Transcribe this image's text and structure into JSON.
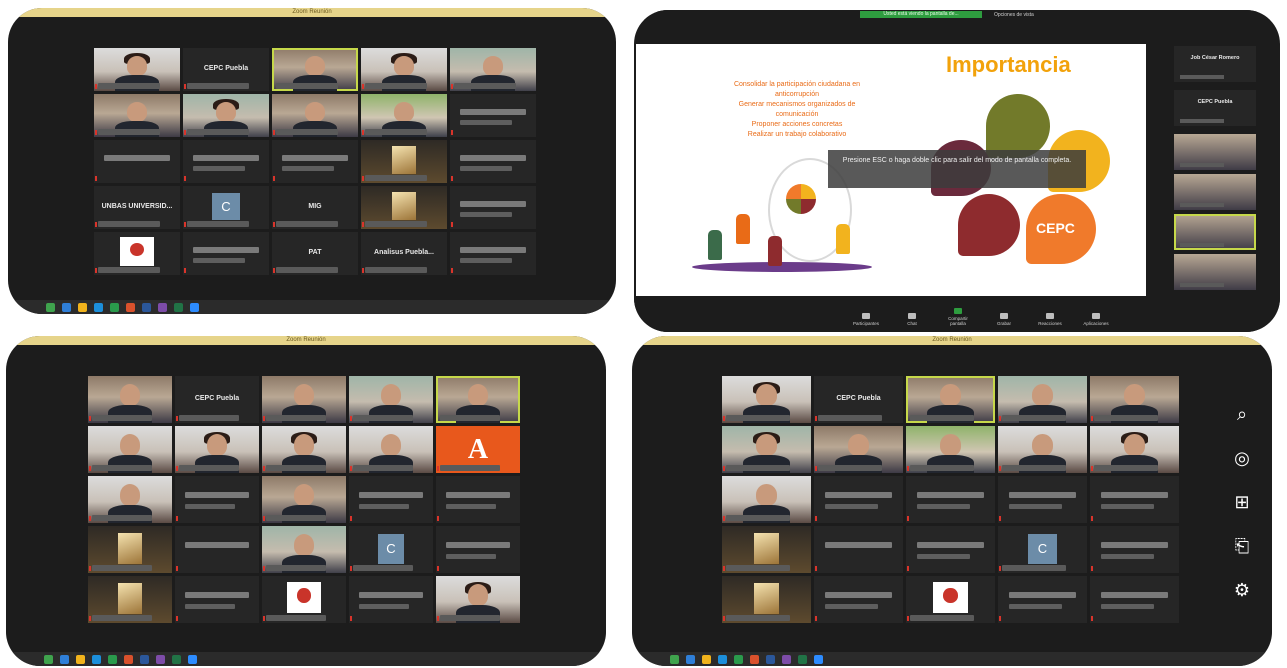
{
  "windows": [
    {
      "title": "Zoom Reunión",
      "labels": [
        "CEPC Puebla",
        "UNBAS UNIVERSID...",
        "C",
        "MIG",
        "PAT",
        "Analisus Puebla..."
      ]
    },
    {
      "green_banner": "Usted está viendo la pantalla de...",
      "view_label": "Opciones de vista",
      "slide_title": "Importancia",
      "bullets": [
        "Consolidar la participación ciudadana en",
        "anticorrupción",
        "Generar mecanismos organizados de",
        "comunicación",
        "Proponer acciones concretas",
        "Realizar un trabajo colaborativo"
      ],
      "petal_label": "CEPC",
      "tooltip": "Presione ESC o haga doble clic para salir del modo de pantalla completa.",
      "side": [
        "Job César Romero",
        "CEPC Puebla"
      ],
      "controls": [
        "Participantes",
        "Chat",
        "Compartir pantalla",
        "Grabar",
        "Reacciones",
        "Aplicaciones"
      ]
    },
    {
      "title": "Zoom Reunión",
      "labels": [
        "CEPC Puebla",
        "A",
        "C"
      ]
    },
    {
      "title": "Zoom Reunión",
      "labels": [
        "CEPC Puebla",
        "C"
      ]
    }
  ],
  "charms": [
    "search-icon",
    "share-icon",
    "windows-start-icon",
    "devices-icon",
    "settings-icon"
  ],
  "colors": {
    "window": "#1c1c1c",
    "tile": "#262626",
    "highlight": "#c6d84a",
    "slide_title": "#f2a20b",
    "bullets": "#e96b17",
    "zoom_green": "#2e9d3f"
  }
}
